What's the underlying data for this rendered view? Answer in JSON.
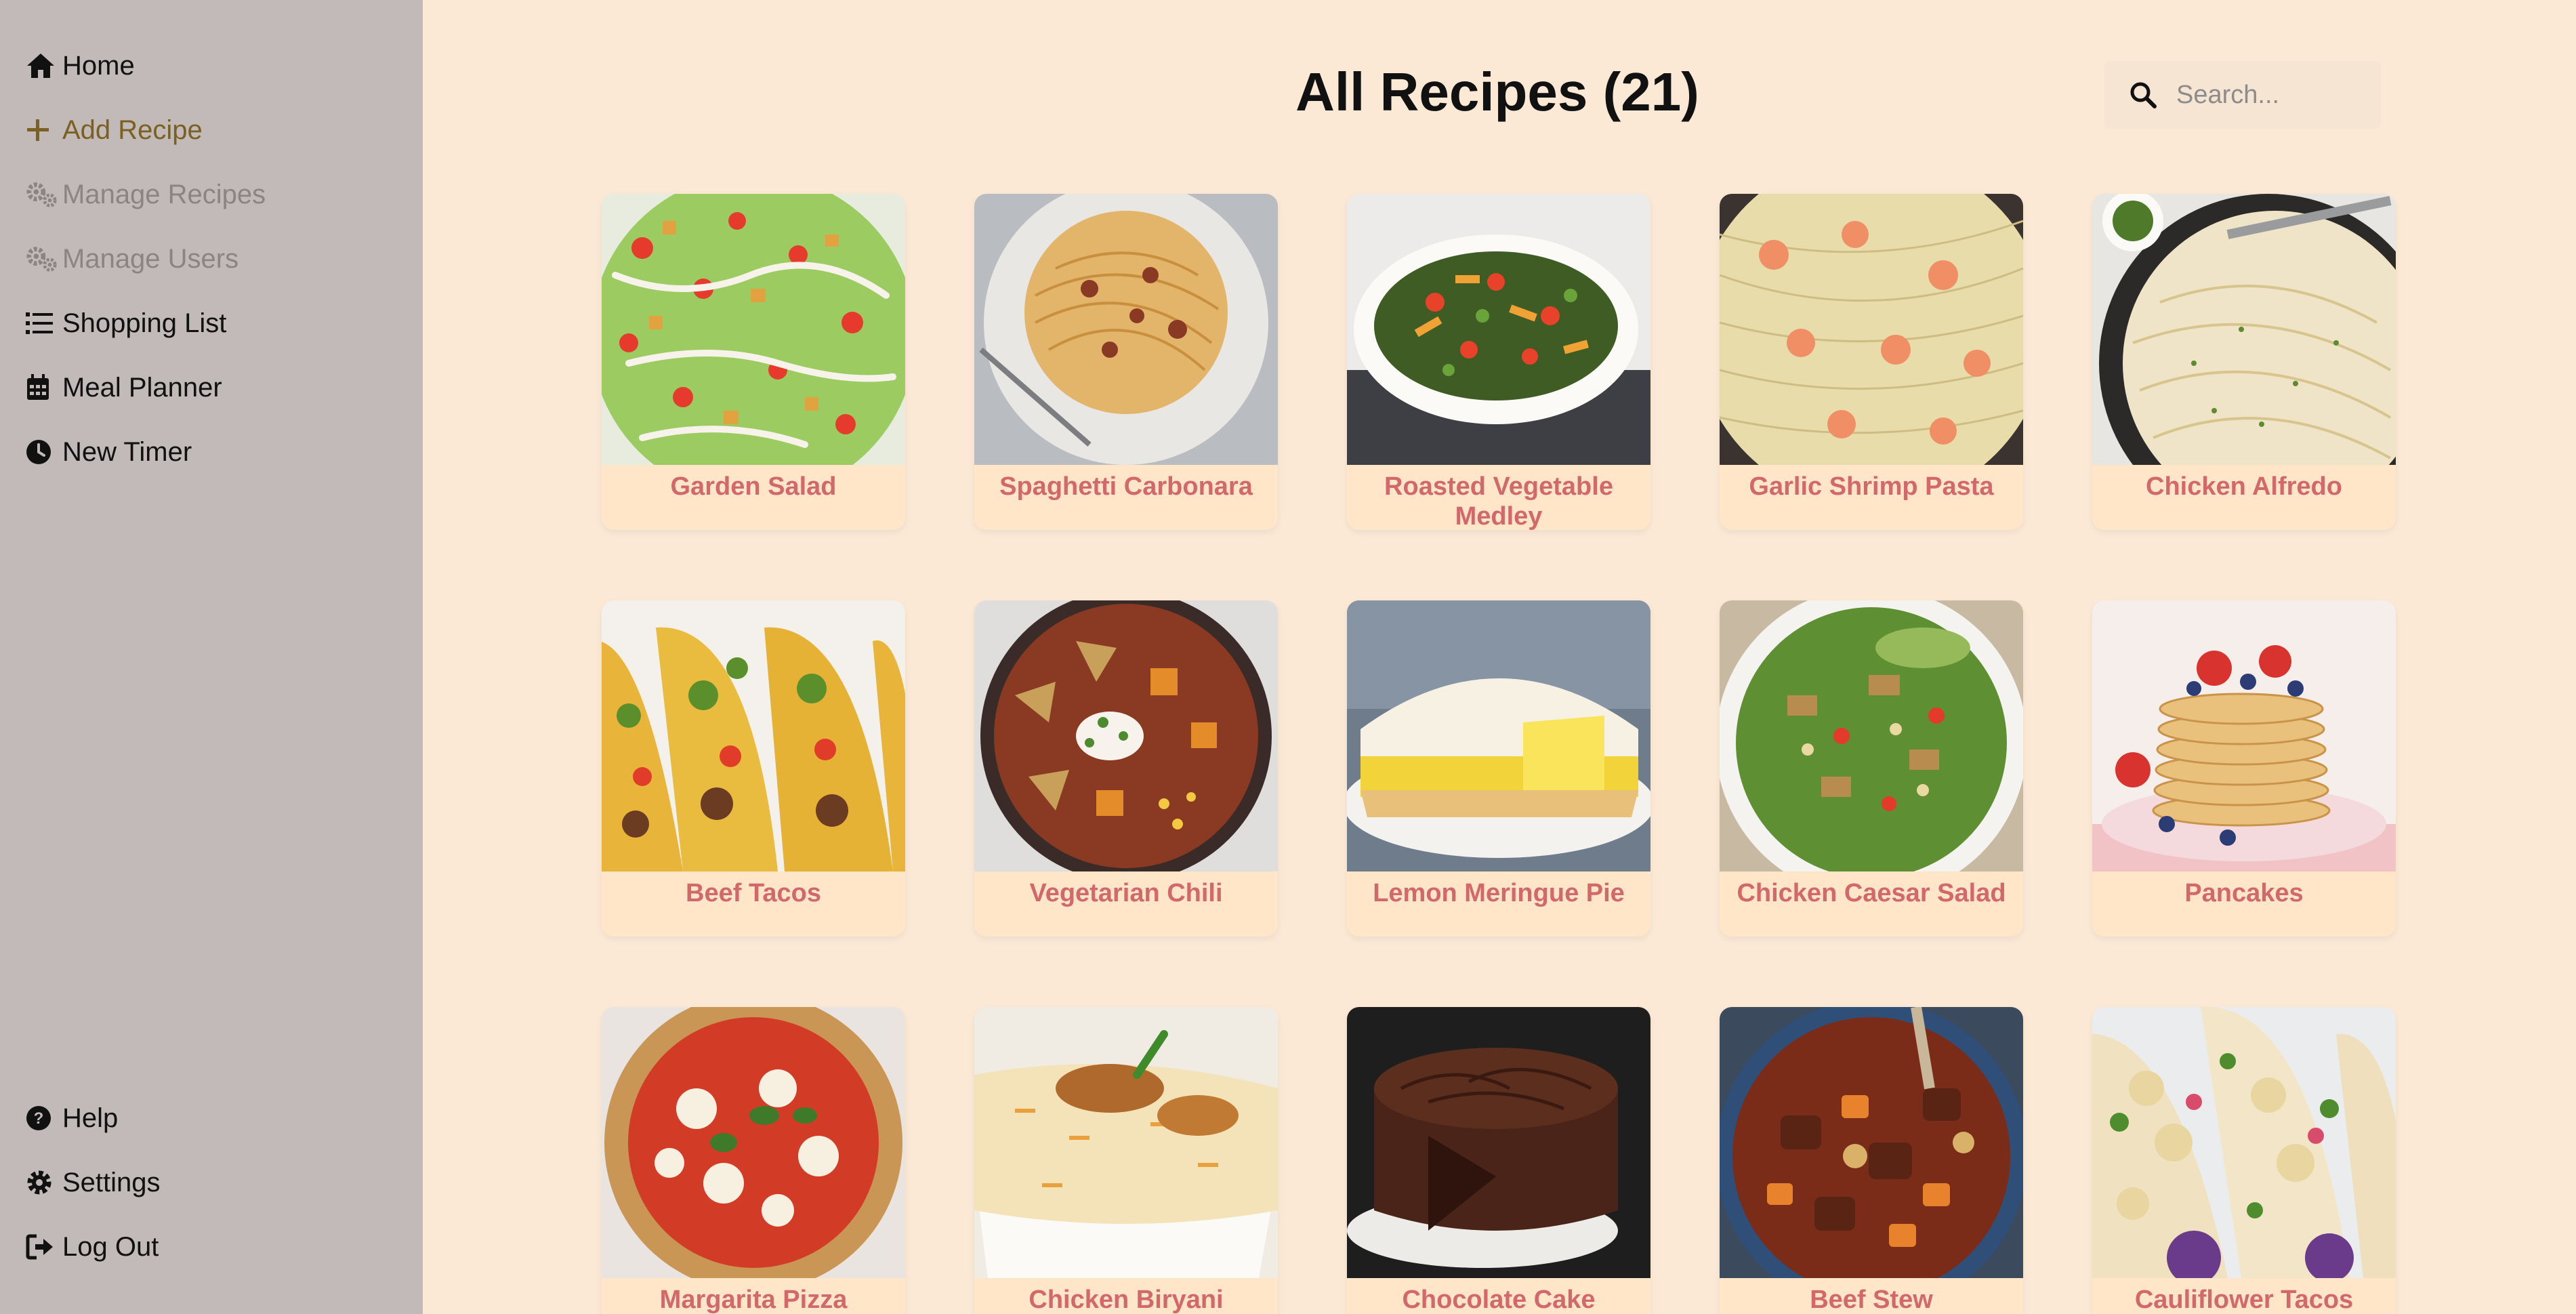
{
  "sidebar": {
    "items": [
      {
        "label": "Home",
        "icon": "home-icon"
      },
      {
        "label": "Add Recipe",
        "icon": "plus-icon"
      },
      {
        "label": "Manage Recipes",
        "icon": "gears-icon"
      },
      {
        "label": "Manage Users",
        "icon": "gears-icon"
      },
      {
        "label": "Shopping List",
        "icon": "list-icon"
      },
      {
        "label": "Meal Planner",
        "icon": "calendar-icon"
      },
      {
        "label": "New Timer",
        "icon": "clock-icon"
      }
    ],
    "bottom_items": [
      {
        "label": "Help",
        "icon": "question-icon"
      },
      {
        "label": "Settings",
        "icon": "gear-icon"
      },
      {
        "label": "Log Out",
        "icon": "logout-icon"
      }
    ]
  },
  "header": {
    "title": "All Recipes (21)",
    "search_placeholder": "Search..."
  },
  "recipes": [
    {
      "name": "Garden Salad"
    },
    {
      "name": "Spaghetti Carbonara"
    },
    {
      "name": "Roasted Vegetable Medley"
    },
    {
      "name": "Garlic Shrimp Pasta"
    },
    {
      "name": "Chicken Alfredo"
    },
    {
      "name": "Beef Tacos"
    },
    {
      "name": "Vegetarian Chili"
    },
    {
      "name": "Lemon Meringue Pie"
    },
    {
      "name": "Chicken Caesar Salad"
    },
    {
      "name": "Pancakes"
    },
    {
      "name": "Margarita Pizza"
    },
    {
      "name": "Chicken Biryani"
    },
    {
      "name": "Chocolate Cake"
    },
    {
      "name": "Beef Stew"
    },
    {
      "name": "Cauliflower Tacos"
    }
  ],
  "colors": {
    "background": "#fbe9d6",
    "sidebar": "#c1bab9",
    "card": "#ffe6c8",
    "recipe_name": "#d3686a",
    "add_recipe": "#7b6022",
    "disabled": "#8a8584"
  }
}
